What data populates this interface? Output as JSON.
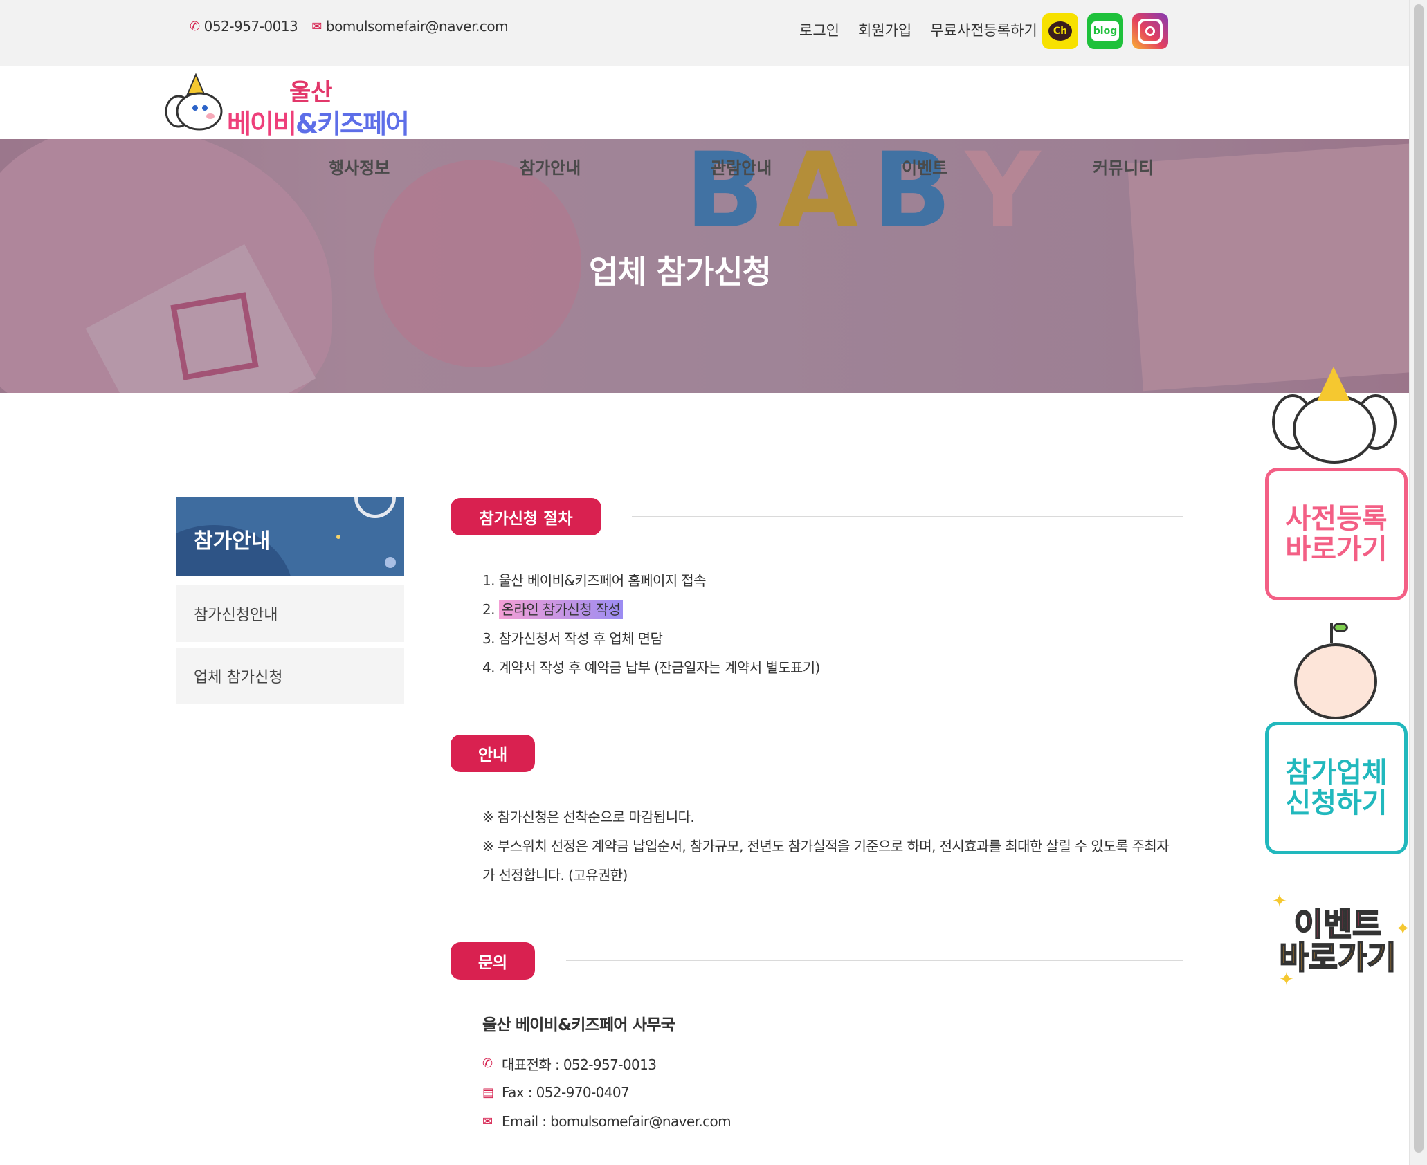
{
  "topbar": {
    "phone": "052-957-0013",
    "email": "bomulsomefair@naver.com",
    "links": [
      "로그인",
      "회원가입",
      "무료사전등록하기"
    ],
    "social": [
      {
        "name": "kakao-channel",
        "label": "Ch"
      },
      {
        "name": "blog",
        "label": "blog"
      },
      {
        "name": "instagram",
        "label": ""
      }
    ]
  },
  "logo": {
    "line1": "울산",
    "line2a": "베이비",
    "line2b": "&키즈페어"
  },
  "hero": {
    "nav": [
      "행사정보",
      "참가안내",
      "관람안내",
      "이벤트",
      "커뮤니티"
    ],
    "letters": [
      "B",
      "A",
      "B",
      "Y"
    ],
    "title": "업체 참가신청"
  },
  "sidebar": {
    "title": "참가안내",
    "items": [
      "참가신청안내",
      "업체 참가신청"
    ]
  },
  "procedure": {
    "badge": "참가신청 절차",
    "steps": [
      "1. 울산 베이비&키즈페어 홈페이지 접속",
      "2. ",
      "3. 참가신청서 작성 후 업체 면담",
      "4. 계약서 작성 후 예약금 납부 (잔금일자는 계약서 별도표기)"
    ],
    "highlight": "온라인 참가신청 작성"
  },
  "notice": {
    "badge": "안내",
    "lines": [
      "※ 참가신청은 선착순으로 마감됩니다.",
      "※ 부스위치 선정은 계약금 납입순서, 참가규모, 전년도 참가실적을 기준으로 하며, 전시효과를 최대한 살릴 수 있도록 주최자",
      "가 선정합니다. (고유권한)"
    ]
  },
  "inquiry": {
    "badge": "문의",
    "title": "울산 베이비&키즈페어 사무국",
    "phone": "대표전화 : 052-957-0013",
    "fax": "Fax : 052-970-0407",
    "email": "Email : bomulsomefair@naver.com"
  },
  "floating": {
    "preregister": [
      "사전등록",
      "바로가기"
    ],
    "exhibitor": [
      "참가업체",
      "신청하기"
    ],
    "event": [
      "이벤트",
      "바로가기"
    ]
  },
  "colors": {
    "accent": "#d92150",
    "sidebar": "#3e6c9f",
    "pink": "#f35f85",
    "teal": "#21b8bd"
  }
}
